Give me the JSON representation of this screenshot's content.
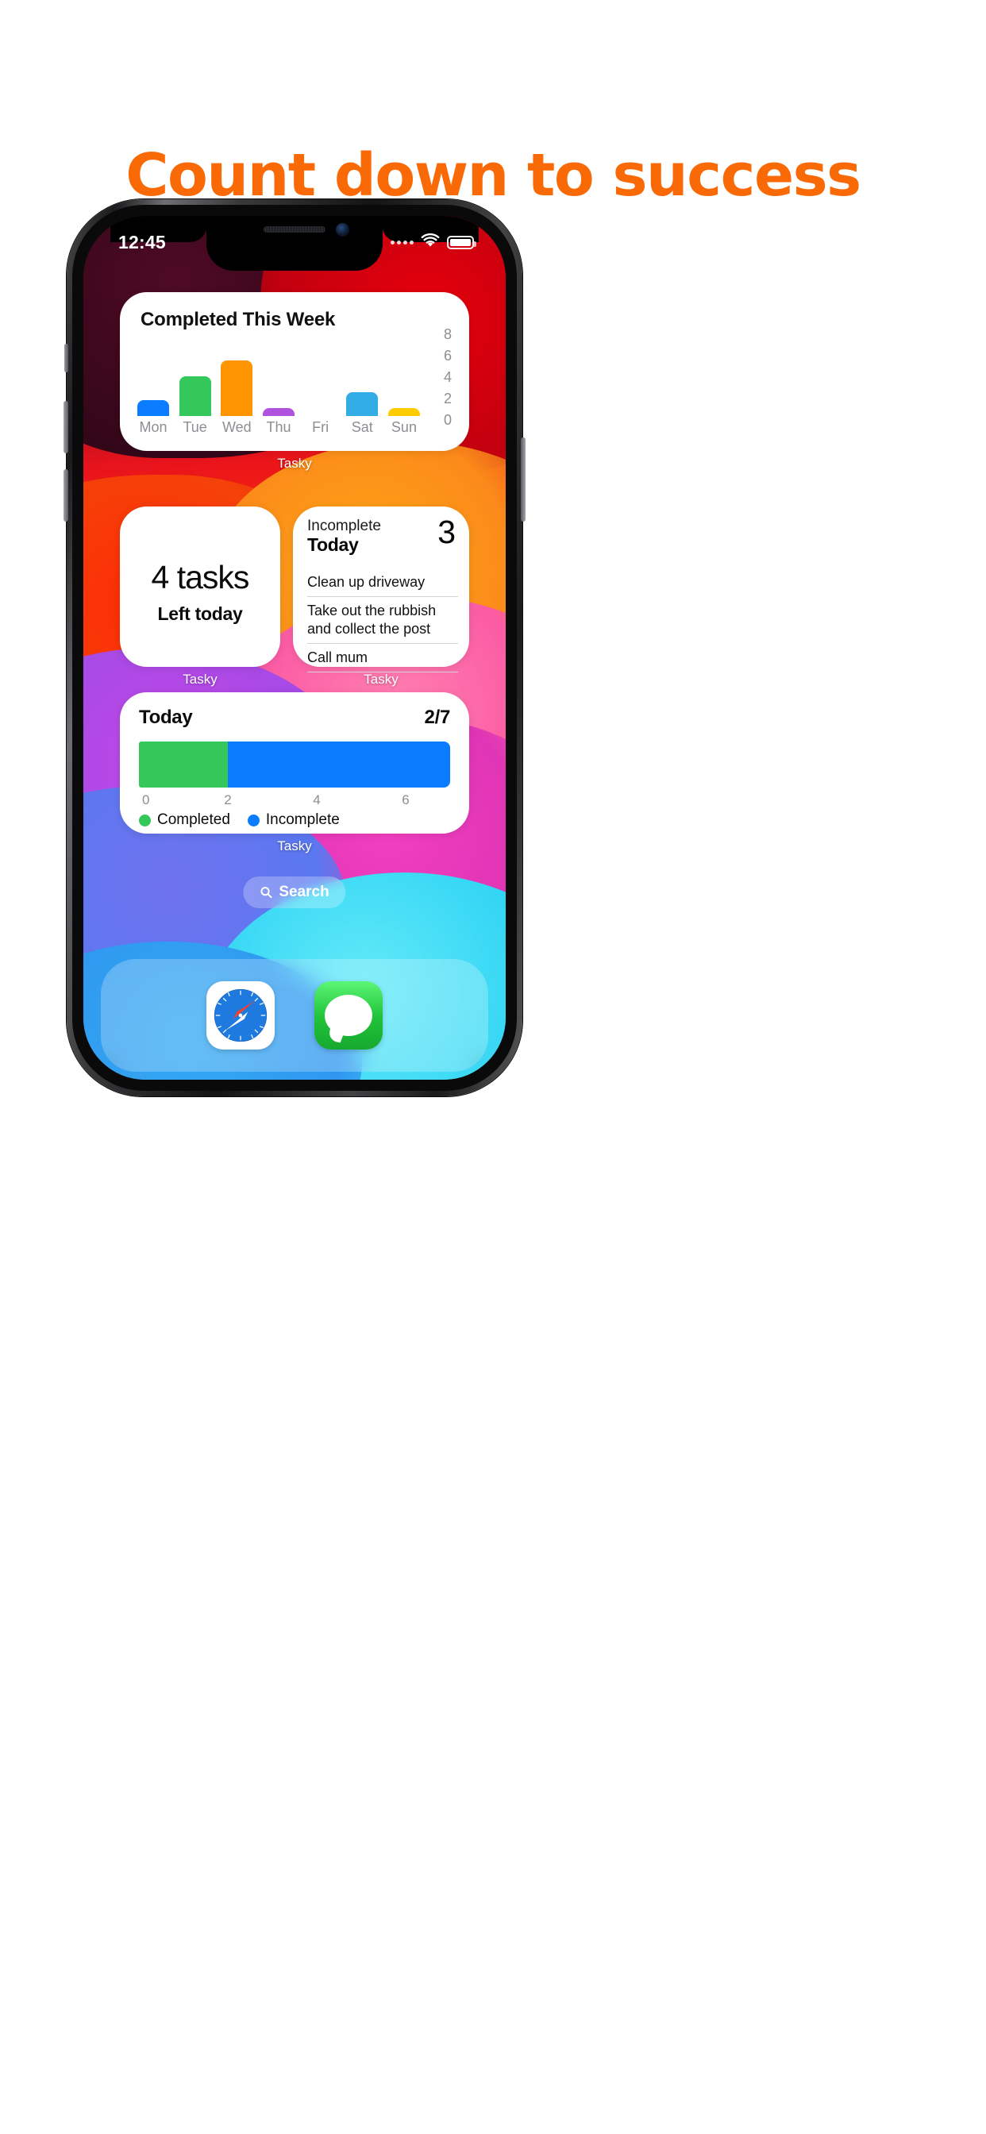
{
  "headline": "Count down to success",
  "brand_color": "#F96A07",
  "status_bar": {
    "time": "12:45",
    "signal_icon": "signal-dots-icon",
    "wifi_icon": "wifi-icon",
    "battery_icon": "battery-icon"
  },
  "widgets": {
    "chart": {
      "title": "Completed This Week",
      "name_label": "Tasky"
    },
    "tasks_left": {
      "count_text": "4 tasks",
      "subtitle": "Left today",
      "name_label": "Tasky"
    },
    "incomplete": {
      "kicker": "Incomplete",
      "title": "Today",
      "count": "3",
      "items": [
        "Clean up driveway",
        "Take out the rubbish and collect the post",
        "Call mum"
      ],
      "name_label": "Tasky"
    },
    "today_progress": {
      "title": "Today",
      "fraction": "2/7",
      "name_label": "Tasky"
    }
  },
  "search": {
    "label": "Search",
    "icon": "search-icon"
  },
  "dock": {
    "apps": [
      {
        "name": "Safari",
        "icon": "safari-icon"
      },
      {
        "name": "Messages",
        "icon": "messages-icon"
      }
    ]
  },
  "chart_data": [
    {
      "type": "bar",
      "title": "Completed This Week",
      "categories": [
        "Mon",
        "Tue",
        "Wed",
        "Thu",
        "Fri",
        "Sat",
        "Sun"
      ],
      "values": [
        2,
        5,
        7,
        1,
        0,
        3,
        1
      ],
      "colors": [
        "#0A7CFF",
        "#34C759",
        "#FF9500",
        "#AF52DE",
        "#FF3B30",
        "#32ADE6",
        "#FFCC00"
      ],
      "ylabel": "",
      "xlabel": "",
      "ylim": [
        0,
        8
      ],
      "yticks": [
        0,
        2,
        4,
        6,
        8
      ],
      "ytick_labels": [
        "0",
        "2",
        "4",
        "6",
        "8"
      ],
      "axis_position": "right",
      "grid": false,
      "legend": "none"
    },
    {
      "type": "bar",
      "orientation": "horizontal",
      "stacked": true,
      "title": "Today",
      "annotation": "2/7",
      "categories": [
        "Today"
      ],
      "series": [
        {
          "name": "Completed",
          "values": [
            2
          ],
          "color": "#34C759"
        },
        {
          "name": "Incomplete",
          "values": [
            5
          ],
          "color": "#0A7CFF"
        }
      ],
      "xlim": [
        0,
        7
      ],
      "xticks": [
        0,
        2,
        4,
        6
      ],
      "xtick_labels": [
        "0",
        "2",
        "4",
        "6"
      ],
      "grid": false,
      "legend": "bottom-left"
    }
  ]
}
